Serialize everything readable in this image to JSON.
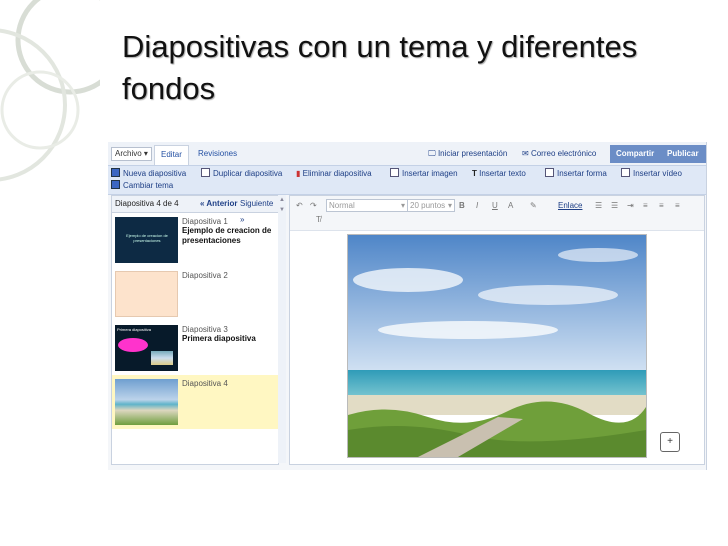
{
  "slide": {
    "title": "Diapositivas con un tema y diferentes fondos"
  },
  "app": {
    "menu_archivo": "Archivo",
    "tabs": [
      "Editar",
      "Revisiones"
    ],
    "top_actions": {
      "iniciar": "Iniciar presentación",
      "correo": "Correo electrónico"
    },
    "buttons": {
      "compartir": "Compartir",
      "publicar": "Publicar"
    },
    "toolbar": {
      "nueva": "Nueva diapositiva",
      "duplicar": "Duplicar diapositiva",
      "eliminar": "Eliminar diapositiva",
      "insertar_imagen": "Insertar imagen",
      "insertar_texto": "Insertar texto",
      "insertar_forma": "Insertar forma",
      "insertar_video": "Insertar vídeo",
      "cambiar_tema": "Cambiar tema"
    },
    "sidebar": {
      "counter": "Diapositiva 4 de 4",
      "prev": "« Anterior",
      "next": "Siguiente »",
      "slides": [
        {
          "label": "Diapositiva 1",
          "title": "Ejemplo de creacion de presentaciones",
          "thumb_text": "Ejemplo de creacion de presentaciones"
        },
        {
          "label": "Diapositiva 2",
          "title": ""
        },
        {
          "label": "Diapositiva 3",
          "title": "Primera diapositiva",
          "thumb_text": "Primera diapositiva"
        },
        {
          "label": "Diapositiva 4",
          "title": ""
        }
      ]
    },
    "format": {
      "font_style": "Normal",
      "font_size": "20 puntos",
      "bold": "B",
      "italic": "I",
      "underline": "U",
      "text_color": "A",
      "link": "Enlace"
    }
  },
  "colors": {
    "accent_blue": "#6b8dc6",
    "link_blue": "#1e3f86",
    "selected_row": "#fff7c2",
    "slide1_bg": "#0d2a44",
    "slide2_bg": "#fde3cc"
  }
}
